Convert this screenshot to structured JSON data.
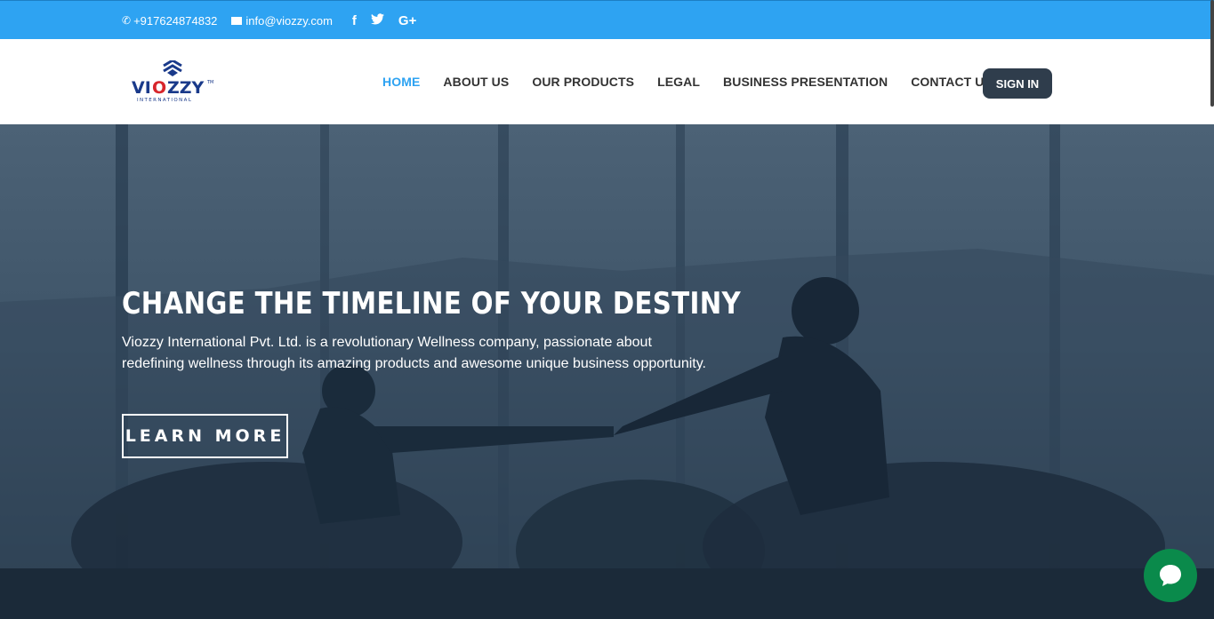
{
  "topbar": {
    "phone": "+917624874832",
    "email": "info@viozzy.com",
    "social": [
      {
        "icon": "facebook-icon",
        "glyph": "f"
      },
      {
        "icon": "twitter-icon",
        "glyph": "🐦"
      },
      {
        "icon": "google-plus-icon",
        "glyph": "G+"
      }
    ]
  },
  "header": {
    "logo_text": "VIOZZY",
    "logo_sub": "INTERNATIONAL",
    "nav": [
      {
        "label": "HOME",
        "active": true
      },
      {
        "label": "ABOUT US"
      },
      {
        "label": "OUR PRODUCTS"
      },
      {
        "label": "LEGAL"
      },
      {
        "label": "BUSINESS PRESENTATION"
      },
      {
        "label": "CONTACT US"
      }
    ],
    "signin_label": "SIGN IN"
  },
  "hero": {
    "title": "CHANGE THE TIMELINE OF YOUR DESTINY",
    "text": "Viozzy International Pvt. Ltd. is a revolutionary Wellness company, passionate about redefining wellness through its amazing products and awesome unique business opportunity.",
    "button_label": "LEARN MORE"
  },
  "colors": {
    "accent": "#2ea3f2",
    "signin_bg": "#2f3d4c",
    "chat_bg": "#0a8a4b"
  }
}
